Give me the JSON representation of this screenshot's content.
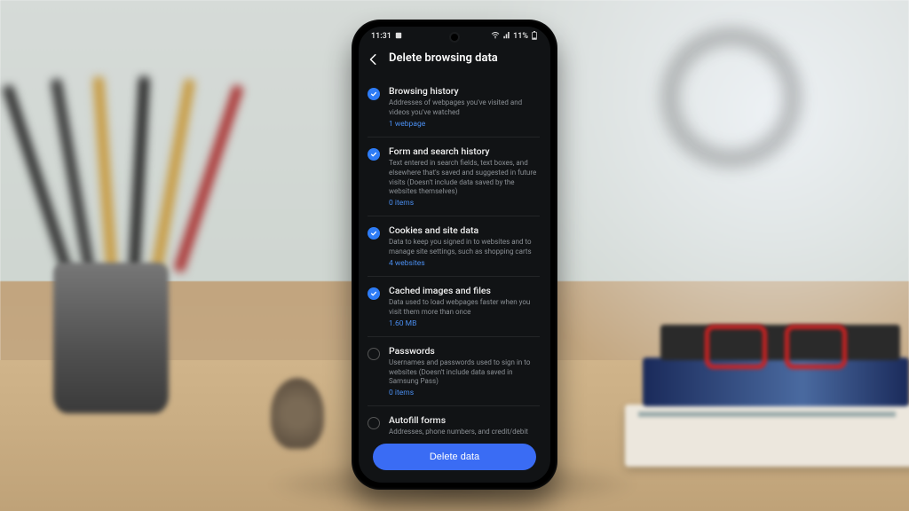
{
  "status": {
    "time": "11:31",
    "battery_text": "11%"
  },
  "header": {
    "title": "Delete browsing data"
  },
  "items": [
    {
      "checked": true,
      "title": "Browsing history",
      "desc": "Addresses of webpages you've visited and videos you've watched",
      "stat": "1 webpage"
    },
    {
      "checked": true,
      "title": "Form and search history",
      "desc": "Text entered in search fields, text boxes, and elsewhere that's saved and suggested in future visits (Doesn't include data saved by the websites themselves)",
      "stat": "0 items"
    },
    {
      "checked": true,
      "title": "Cookies and site data",
      "desc": "Data to keep you signed in to websites and to manage site settings, such as shopping carts",
      "stat": "4 websites"
    },
    {
      "checked": true,
      "title": "Cached images and files",
      "desc": "Data used to load webpages faster when you visit them more than once",
      "stat": "1.60 MB"
    },
    {
      "checked": false,
      "title": "Passwords",
      "desc": "Usernames and passwords used to sign in to websites (Doesn't include data saved in Samsung Pass)",
      "stat": "0 items"
    },
    {
      "checked": false,
      "title": "Autofill forms",
      "desc": "Addresses, phone numbers, and credit/debit card",
      "stat": ""
    }
  ],
  "footer": {
    "button": "Delete data"
  }
}
